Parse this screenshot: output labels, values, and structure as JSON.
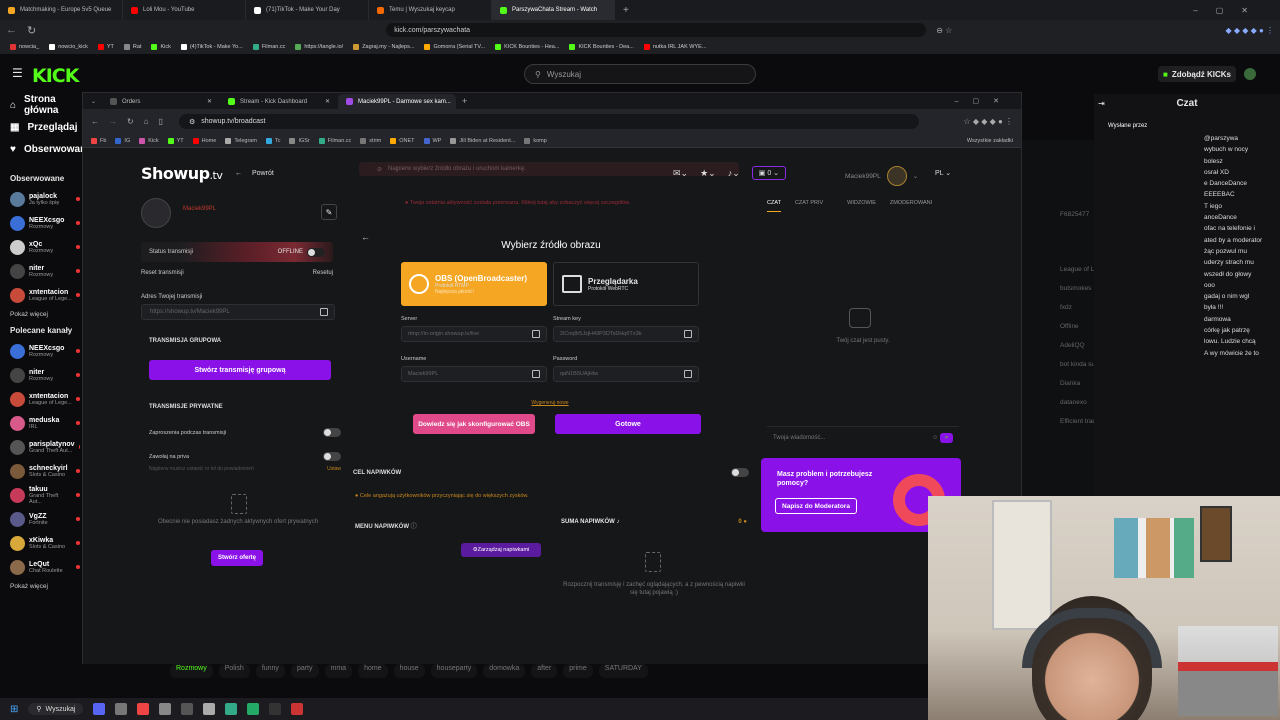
{
  "outer_tabs": [
    {
      "label": "Matchmaking - Europe 5v5 Queue",
      "color": "#f5a623"
    },
    {
      "label": "Loli Mou - YouTube",
      "color": "#ff0000"
    },
    {
      "label": "(71)TikTok - Make Your Day",
      "color": "#ffffff"
    },
    {
      "label": "Temu | Wyszukaj keycap",
      "color": "#f56a00"
    },
    {
      "label": "ParszywaChata Stream - Watch",
      "color": "#53fc18"
    }
  ],
  "outer_url": "kick.com/parszywachata",
  "outer_bookmarks": [
    "nowcia_",
    "nowcio_kick",
    "YT",
    "Rat",
    "Kick",
    "(4)TikTok - Make Yo...",
    "Filman.cc",
    "https://tangle.io/",
    "Zagraj.my - Najleps...",
    "Gomorra (Serial TV...",
    "KICK Bounties - Hea...",
    "KICK Bounties - Dea...",
    "nutka IRL JAK WYE..."
  ],
  "kick": {
    "logo": "KICK",
    "search_placeholder": "Wyszukaj",
    "kicks_button": "Zdobądź KICKs",
    "nav": [
      "Strona główna",
      "Przeglądaj",
      "Obserwowane"
    ],
    "followed_title": "Obserwowane",
    "followed": [
      {
        "name": "pajalock",
        "sub": "Ja tylko śpię",
        "color": "#5a7a9c"
      },
      {
        "name": "NEEXcsgo",
        "sub": "Rozmowy",
        "color": "#3a6fd8"
      },
      {
        "name": "xQc",
        "sub": "Rozmowy",
        "color": "#ccc"
      },
      {
        "name": "niter",
        "sub": "Rozmowy",
        "color": "#444"
      },
      {
        "name": "xntentacion",
        "sub": "League of Lege...",
        "color": "#c84a3a"
      }
    ],
    "more": "Pokaż więcej",
    "recommended_title": "Polecane kanały",
    "recommended": [
      {
        "name": "NEEXcsgo",
        "sub": "Rozmowy",
        "color": "#3a6fd8"
      },
      {
        "name": "niter",
        "sub": "Rozmowy",
        "color": "#444"
      },
      {
        "name": "xntentacion",
        "sub": "League of Lege...",
        "color": "#c84a3a"
      },
      {
        "name": "meduska",
        "sub": "IRL",
        "color": "#d85a8a"
      },
      {
        "name": "parisplatynov",
        "sub": "Grand Theft Aut...",
        "color": "#555"
      },
      {
        "name": "schneckyirl",
        "sub": "Slots & Casino",
        "color": "#7a5a3a"
      },
      {
        "name": "takuu",
        "sub": "Grand Theft Aut...",
        "color": "#c83a5a"
      },
      {
        "name": "VgZZ",
        "sub": "Fortnite",
        "color": "#5a5a8a"
      },
      {
        "name": "xKiwka",
        "sub": "Slots & Casino",
        "color": "#d8a83a"
      },
      {
        "name": "LeQut",
        "sub": "Chat Roulette",
        "color": "#8a6a4a"
      }
    ],
    "more2": "Pokaż więcej",
    "tags": [
      "Rozmowy",
      "Polish",
      "funny",
      "party",
      "mma",
      "home",
      "house",
      "houseparty",
      "domowka",
      "after",
      "prime",
      "SATURDAY"
    ],
    "chat_title": "Czat",
    "chat_sent_by": "Wysłane przez",
    "chat_lines": [
      "@parszywa",
      "wybuch w nocy",
      "bolesz",
      "osrał XD",
      "e DanceDance",
      "EEEEBAC",
      "T iego",
      "anceDance",
      "ofac na telefonie i",
      "ated by a moderator",
      "żąc pozwul mu",
      "uderzy strach mu",
      "wszedł do głowy",
      "ooo",
      "gadaj o nim wgl",
      "była !!!",
      "darmowa",
      "córkę jak patrzę",
      "lowu. Ludzie chcą",
      "A wy mówicie że to"
    ]
  },
  "overlay_lines": [
    "F6825477",
    "League of Legends",
    "butsmokes",
    "fxdz",
    "Offline",
    "AdeliQQ",
    "bot kinda sus",
    "Dianka",
    "datanexo",
    "Efficient trade"
  ],
  "window": {
    "tabs": [
      "Orders",
      "Stream - Kick Dashboard",
      "Maciek99PL - Darmowe sex kam..."
    ],
    "url": "showup.tv/broadcast",
    "bookmarks": [
      "Fb",
      "IG",
      "Kick",
      "YT",
      "Home",
      "Telegram",
      "Tc",
      "IGSr",
      "Filman.cc",
      "strim",
      "ONET",
      "WP",
      "Jill Biden at Resident...",
      "komp"
    ],
    "all_bookmarks": "Wszystkie zakładki"
  },
  "showup": {
    "logo": "Showup",
    "logo_tld": ".tv",
    "back": "Powrót",
    "hint": "Najpierw wybierz źródło obrazu i uruchom kamerkę.",
    "wallet": "0",
    "username": "Maciek99PL",
    "lang": "PL",
    "profile_name": "Maciek99PL",
    "status_label": "Status transmisji",
    "status_value": "OFFLINE",
    "reset_label": "Reset transmisji",
    "reset_button": "Resetuj",
    "addr_label": "Adres Twojej transmisji",
    "addr_value": "https://showup.tv/Maciek99PL",
    "group_title": "TRANSMISJA GRUPOWA",
    "group_button": "Stwórz transmisję grupową",
    "private_title": "TRANSMISJE PRYWATNE",
    "private_invites": "Zaproszenia podczas transmisji",
    "private_call": "Zawołaj na priva",
    "private_note": "Najpierw musisz ustawić nr tel do powiadomień",
    "private_note_link": "Ustaw",
    "offers_empty": "Obecnie nie posiadasz żadnych aktywnych ofert prywatnych",
    "offer_button": "Stwórz ofertę",
    "warn": "Twoja ostatnia aktywność została przerwana. Kliknij tutaj aby zobaczyć więcej szczegółów.",
    "choose_title": "Wybierz źródło obrazu",
    "obs_title": "OBS (OpenBroadcaster)",
    "obs_sub": "Protokół RTMP",
    "obs_sub2": "Najlepsza jakość!",
    "browser_title": "Przeglądarka",
    "browser_sub": "Protokół WebRTC",
    "server_label": "Server",
    "server_value": "rtmp://in-origin.showup.tv/live",
    "key_label": "Stream key",
    "key_value": "2iCnq8r5JzjH49P3DTsDHq6Tx3b",
    "user_label": "Username",
    "user_value": "Maciek99PL",
    "pass_label": "Password",
    "pass_value": "qaN1B5UAjHtw",
    "generate_link": "Wygeneruj nowe",
    "obs_help_button": "Dowiedz się jak skonfigurować OBS",
    "done_button": "Gotowe",
    "goal_title": "CEL NAPIWKÓW",
    "goal_warn": "Cele angażują użytkowników przyczyniając się do większych zysków.",
    "tips_menu": "MENU NAPIWKÓW",
    "manage_tips": "Zarządzaj napiwkami",
    "tips_sum": "SUMA NAPIWKÓW",
    "tips_sum_value": "0",
    "tips_empty": "Rozpocznij transmisję i zachęć oglądających, a z pewnością napiwki się tutaj pojawią :)",
    "chat_tabs": [
      "CZAT",
      "CZAT PRIV",
      "WIDZOWIE",
      "ZMODEROWANI"
    ],
    "chat_empty": "Twój czat jest pusty.",
    "chat_placeholder": "Twoja wiadomość...",
    "help_title": "Masz problem i potrzebujesz pomocy?",
    "help_button": "Napisz do Moderatora"
  },
  "taskbar_search": "Wyszukaj"
}
